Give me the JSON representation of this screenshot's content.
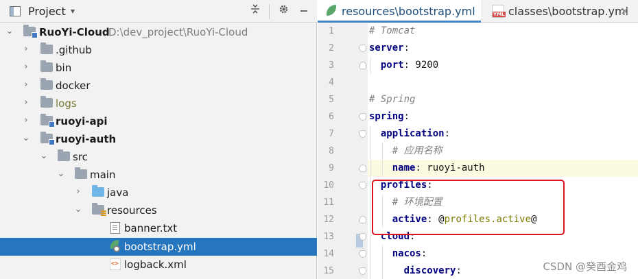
{
  "project_panel": {
    "title": "Project",
    "chevron": "▾",
    "toolbar_icons": [
      "collapse-icon",
      "gear-icon",
      "minimize-icon"
    ],
    "tree": [
      {
        "label": "RuoYi-Cloud",
        "path": "D:\\dev_project\\RuoYi-Cloud",
        "kind": "module",
        "bold": true,
        "expanded": true,
        "depth": 0
      },
      {
        "label": ".github",
        "kind": "folder",
        "expanded": false,
        "depth": 1
      },
      {
        "label": "bin",
        "kind": "folder",
        "expanded": false,
        "depth": 1
      },
      {
        "label": "docker",
        "kind": "folder",
        "expanded": false,
        "depth": 1
      },
      {
        "label": "logs",
        "kind": "folder",
        "muted": true,
        "expanded": false,
        "depth": 1
      },
      {
        "label": "ruoyi-api",
        "kind": "module",
        "bold": true,
        "expanded": false,
        "depth": 1
      },
      {
        "label": "ruoyi-auth",
        "kind": "module",
        "bold": true,
        "expanded": true,
        "depth": 1
      },
      {
        "label": "src",
        "kind": "folder",
        "expanded": true,
        "depth": 2
      },
      {
        "label": "main",
        "kind": "folder",
        "expanded": true,
        "depth": 3
      },
      {
        "label": "java",
        "kind": "source-folder",
        "expanded": false,
        "depth": 4
      },
      {
        "label": "resources",
        "kind": "resources-folder",
        "expanded": true,
        "depth": 4
      },
      {
        "label": "banner.txt",
        "kind": "txt",
        "depth": 5
      },
      {
        "label": "bootstrap.yml",
        "kind": "spring-yml",
        "selected": true,
        "depth": 5
      },
      {
        "label": "logback.xml",
        "kind": "xml",
        "depth": 5
      }
    ]
  },
  "editor": {
    "tabs": [
      {
        "label": "resources\\bootstrap.yml",
        "icon": "spring-leaf-icon",
        "active": true
      },
      {
        "label": "classes\\bootstrap.yml",
        "icon": "yml-file-icon",
        "active": false,
        "close": "×"
      }
    ],
    "current_line": 9,
    "lines": [
      {
        "n": "1",
        "parts": [
          {
            "t": "# Tomcat",
            "c": "c"
          }
        ]
      },
      {
        "n": "2",
        "parts": [
          {
            "t": "server",
            "c": "k"
          },
          {
            "t": ":",
            "c": "v"
          }
        ]
      },
      {
        "n": "3",
        "parts": [
          {
            "t": "  "
          },
          {
            "t": "port",
            "c": "k"
          },
          {
            "t": ": 9200",
            "c": "v"
          }
        ]
      },
      {
        "n": "4",
        "parts": []
      },
      {
        "n": "5",
        "parts": [
          {
            "t": "# Spring",
            "c": "c"
          }
        ]
      },
      {
        "n": "6",
        "parts": [
          {
            "t": "spring",
            "c": "k"
          },
          {
            "t": ":",
            "c": "v"
          }
        ]
      },
      {
        "n": "7",
        "parts": [
          {
            "t": "  "
          },
          {
            "t": "application",
            "c": "k"
          },
          {
            "t": ":",
            "c": "v"
          }
        ]
      },
      {
        "n": "8",
        "parts": [
          {
            "t": "    "
          },
          {
            "t": "# 应用名称",
            "c": "c"
          }
        ]
      },
      {
        "n": "9",
        "parts": [
          {
            "t": "    "
          },
          {
            "t": "name",
            "c": "k"
          },
          {
            "t": ": ruoyi-auth",
            "c": "v"
          }
        ]
      },
      {
        "n": "10",
        "parts": [
          {
            "t": "  "
          },
          {
            "t": "profiles",
            "c": "k"
          },
          {
            "t": ":",
            "c": "v"
          }
        ]
      },
      {
        "n": "11",
        "parts": [
          {
            "t": "    "
          },
          {
            "t": "# 环境配置",
            "c": "c"
          }
        ]
      },
      {
        "n": "12",
        "parts": [
          {
            "t": "    "
          },
          {
            "t": "active",
            "c": "k"
          },
          {
            "t": ": @",
            "c": "v"
          },
          {
            "t": "profiles.active",
            "c": "ph"
          },
          {
            "t": "@",
            "c": "v"
          }
        ]
      },
      {
        "n": "13",
        "parts": [
          {
            "t": "  "
          },
          {
            "t": "cloud",
            "c": "k"
          },
          {
            "t": ":",
            "c": "v"
          }
        ]
      },
      {
        "n": "14",
        "parts": [
          {
            "t": "    "
          },
          {
            "t": "nacos",
            "c": "k"
          },
          {
            "t": ":",
            "c": "v"
          }
        ]
      },
      {
        "n": "15",
        "parts": [
          {
            "t": "      "
          },
          {
            "t": "discovery",
            "c": "k"
          },
          {
            "t": ":",
            "c": "v"
          }
        ]
      }
    ]
  },
  "watermark": "CSDN @癸酉金鸡",
  "colors": {
    "selection": "#2675bf",
    "annotation_box": "#e0141e",
    "keyword": "#000080",
    "comment": "#808080"
  }
}
